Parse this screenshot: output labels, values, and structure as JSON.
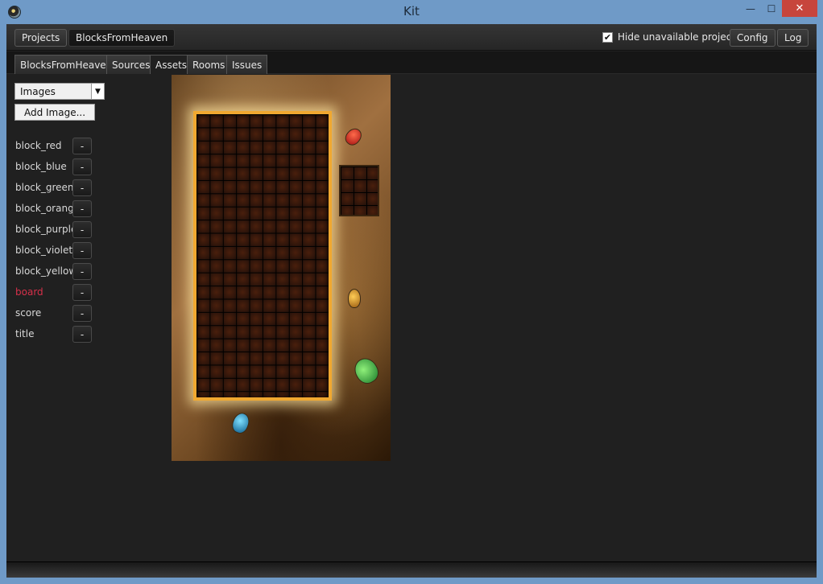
{
  "window": {
    "title": "Kit",
    "controls": {
      "minimize": "—",
      "maximize": "☐",
      "close": "✕"
    }
  },
  "toolbar": {
    "projects_label": "Projects",
    "project_name": "BlocksFromHeaven",
    "hide_unavailable_label": "Hide unavailable projects",
    "hide_unavailable_checked": true,
    "check_mark": "✔",
    "config_label": "Config",
    "log_label": "Log"
  },
  "tabs": [
    {
      "label": "BlocksFromHeaven",
      "active": false
    },
    {
      "label": "Sources",
      "active": false
    },
    {
      "label": "Assets",
      "active": true
    },
    {
      "label": "Rooms",
      "active": false
    },
    {
      "label": "Issues",
      "active": false
    }
  ],
  "assets": {
    "type_selected": "Images",
    "dropdown_arrow": "▼",
    "add_button_label": "Add Image...",
    "remove_label": "-",
    "items": [
      {
        "name": "block_red",
        "selected": false
      },
      {
        "name": "block_blue",
        "selected": false
      },
      {
        "name": "block_green",
        "selected": false
      },
      {
        "name": "block_orange",
        "selected": false
      },
      {
        "name": "block_purple",
        "selected": false
      },
      {
        "name": "block_violet",
        "selected": false
      },
      {
        "name": "block_yellow",
        "selected": false
      },
      {
        "name": "board",
        "selected": true
      },
      {
        "name": "score",
        "selected": false
      },
      {
        "name": "title",
        "selected": false
      }
    ]
  },
  "colors": {
    "selected_text": "#d6304a",
    "close_button": "#c7453c",
    "title_bar": "#6f9ac7"
  }
}
